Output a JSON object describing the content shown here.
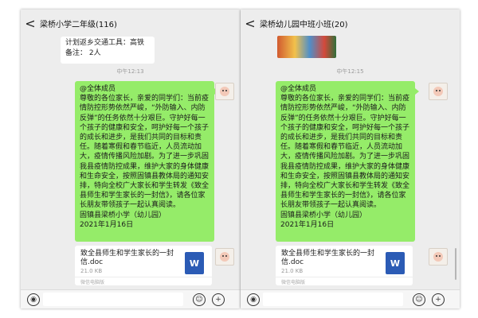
{
  "left": {
    "back": "<",
    "title": "梁桥小学二年级(116)",
    "top_message": [
      "计划返乡交通工具：高铁",
      "备注：  2人"
    ],
    "time": "中午12:13",
    "bubble": "@全体成员\n尊敬的各位家长，亲爱的同学们：当前疫情防控形势依然严峻，“外防输入、内防反弹”的任务依然十分艰巨。守护好每一个孩子的健康和安全，呵护好每一个孩子的成长和进步，是我们共同的目标和责任。随着寒假和春节临近，人员流动加大，疫情传播风险加剧。为了进一步巩固我县疫情防控成果，维护大家的身体健康和生命安全，按照固镇县教体局的通知安排，特向全校广大家长和学生转发《致全县师生和学生家长的一封信》，请各位家长朋友带领孩子一起认真阅读。\n固镇县梁桥小学（幼儿园）\n2021年1月16日",
    "file": {
      "name": "致全县师生和学生家长的一封信.doc",
      "size": "21.0 KB",
      "source": "微信电脑版",
      "icon": "W"
    }
  },
  "right": {
    "back": "<",
    "title": "梁桥幼儿园中班小班(20)",
    "time": "中午12:15",
    "bubble": "@全体成员\n尊敬的各位家长，亲爱的同学们：当前疫情防控形势依然严峻，“外防输入、内防反弹”的任务依然十分艰巨。守护好每一个孩子的健康和安全，呵护好每一个孩子的成长和进步，是我们共同的目标和责任。随着寒假和春节临近，人员流动加大，疫情传播风险加剧。为了进一步巩固我县疫情防控成果，维护大家的身体健康和生命安全，按照固镇县教体局的通知安排，特向全校广大家长和学生转发《致全县师生和学生家长的一封信》，请各位家长朋友带领孩子一起认真阅读。\n固镇县梁桥小学（幼儿园）\n2021年1月16日",
    "file": {
      "name": "致全县师生和学生家长的一封信.doc",
      "size": "21.0 KB",
      "source": "微信电脑版",
      "icon": "W"
    }
  },
  "input_bar": {
    "voice_icon": "voice-icon",
    "emoji_icon": "emoji-icon",
    "plus_icon": "plus-icon"
  },
  "colors": {
    "bubble_green": "#95ec69",
    "chat_bg": "#ededed",
    "word_blue": "#2b5bb5"
  }
}
